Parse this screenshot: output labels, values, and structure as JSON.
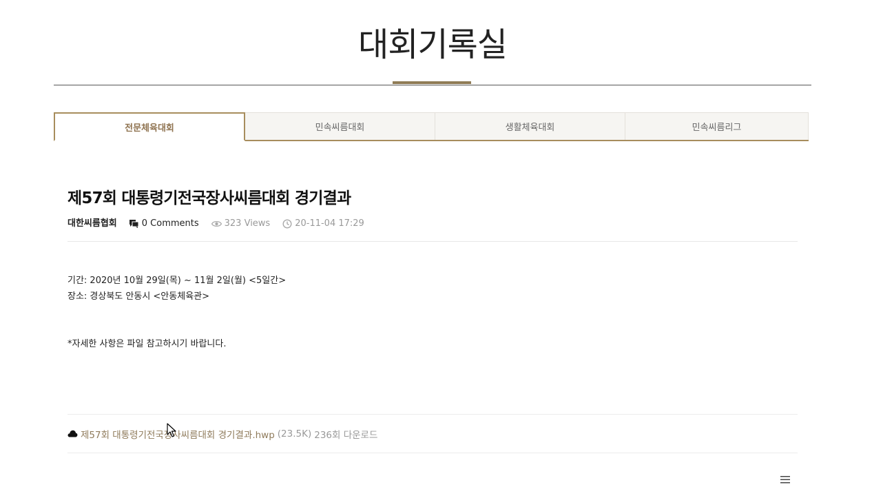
{
  "header": {
    "title": "대회기록실"
  },
  "tabs": [
    {
      "label": "전문체육대회",
      "active": true
    },
    {
      "label": "민속씨름대회",
      "active": false
    },
    {
      "label": "생활체육대회",
      "active": false
    },
    {
      "label": "민속씨름리그",
      "active": false
    }
  ],
  "post": {
    "title": "제57회 대통령기전국장사씨름대회 경기결과",
    "author": "대한씨름협회",
    "comments": "0 Comments",
    "views": "323 Views",
    "date": "20-11-04 17:29",
    "body": {
      "period": "기간: 2020년 10월 29일(목) ~ 11월 2일(월) <5일간>",
      "place": "장소: 경상북도 안동시 <안동체육관>",
      "note": "*자세한 사항은 파일 참고하시기 바랍니다."
    }
  },
  "attachment": {
    "filename": "제57회 대통령기전국장사씨름대회 경기결과.hwp",
    "size": "(23.5K)",
    "downloads": "236회 다운로드"
  },
  "icons": {
    "comments": "comments-icon",
    "views": "eye-icon",
    "date": "clock-icon",
    "attachment": "cloud-download-icon",
    "menu": "hamburger-menu-icon"
  },
  "colors": {
    "accent": "#a78d5c",
    "active_tab_text": "#8f7350",
    "muted": "#999999"
  }
}
